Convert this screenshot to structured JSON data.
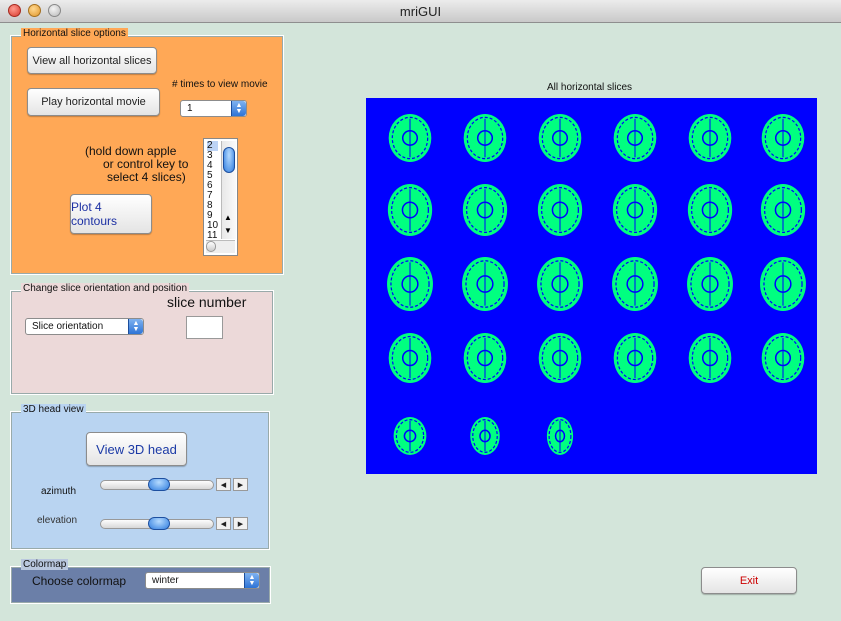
{
  "window": {
    "title": "mriGUI"
  },
  "horizontal": {
    "title": "Horizontal slice options",
    "view_all_label": "View all horizontal slices",
    "play_movie_label": "Play horizontal movie",
    "times_label": "# times to view movie",
    "times_value": "1",
    "hint_lines": [
      "(hold down apple",
      "or control key to",
      "select 4 slices)"
    ],
    "contours_label": "Plot 4 contours",
    "list_items": [
      "2",
      "3",
      "4",
      "5",
      "6",
      "7",
      "8",
      "9",
      "10",
      "11"
    ],
    "bg_color": "#ffa856"
  },
  "orientation": {
    "title": "Change slice orientation and position",
    "select_value": "Slice orientation",
    "slice_number_label": "slice number",
    "slice_number_value": "",
    "bg_color": "#ecd9d9"
  },
  "head": {
    "title": "3D head view",
    "view_label": "View 3D head",
    "azimuth_label": "azimuth",
    "elevation_label": "elevation",
    "bg_color": "#b9d4f1"
  },
  "colormap": {
    "title": "Colormap",
    "choose_label": "Choose colormap",
    "value": "winter",
    "bg_color": "#6b7fa8"
  },
  "image": {
    "title": "All horizontal slices",
    "bg_color": "#0000ff",
    "tissue_color": "#00ff80"
  },
  "exit_label": "Exit",
  "colors": {
    "exit_text": "#cc0000",
    "contours_text": "#1b2fa3",
    "head_text": "#1b3aa6"
  }
}
